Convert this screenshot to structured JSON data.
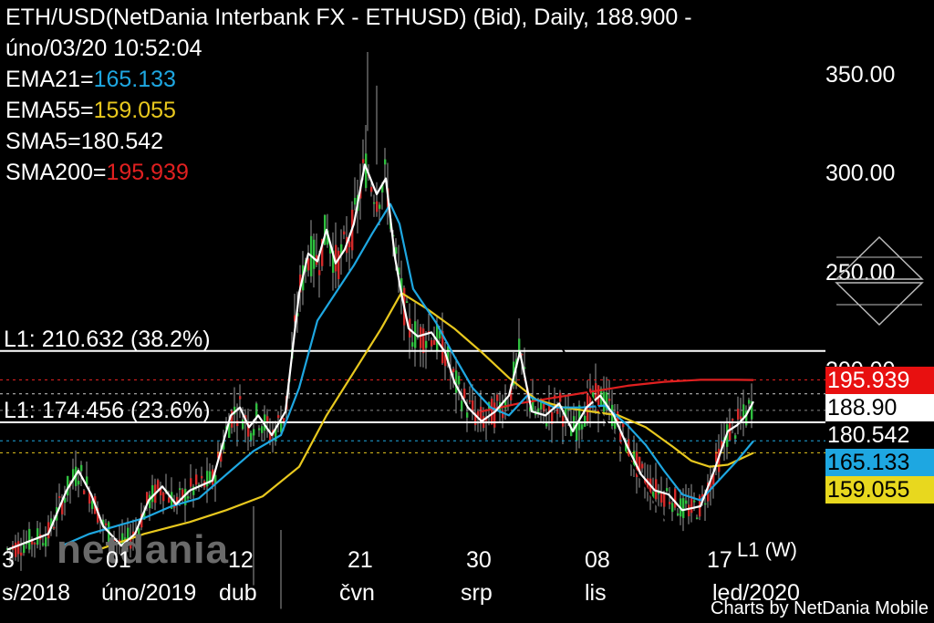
{
  "header": {
    "title_line1": "ETH/USD(NetDania Interbank FX - ETHUSD) (Bid),  Daily, 188.900 -",
    "title_line2": "úno/03/20 10:52:04",
    "indicators": [
      {
        "label": "EMA21=",
        "value": "165.133",
        "color": "#1ea7e1"
      },
      {
        "label": "EMA55=",
        "value": "159.055",
        "color": "#e8c81e"
      },
      {
        "label": "SMA5=",
        "value": "180.542",
        "color": "#ffffff"
      },
      {
        "label": "SMA200=",
        "value": "195.939",
        "color": "#e02020"
      }
    ]
  },
  "y_axis_labels": [
    "350.00",
    "300.00",
    "250.00",
    "200.00"
  ],
  "x_axis": {
    "days": [
      "3",
      "01",
      "12",
      "21",
      "30",
      "08",
      "17"
    ],
    "months": [
      "s/2018",
      "úno/2019",
      "dub",
      "čvn",
      "srp",
      "lis",
      "led/2020"
    ]
  },
  "fibo": [
    {
      "label": "L1: 210.632 (38.2%)",
      "price": 210.632
    },
    {
      "label": "L1: 174.456 (23.6%)",
      "price": 174.456
    }
  ],
  "trendline_label": "L1 (W)",
  "price_tags": [
    {
      "text": "195.939",
      "price": 195.939,
      "bg": "#e81010",
      "fg": "#ffffff"
    },
    {
      "text": "188.90",
      "price": 188.9,
      "bg": "#ffffff",
      "fg": "#000000"
    },
    {
      "text": "180.542",
      "price": 180.542,
      "bg": "#000000",
      "fg": "#ffffff"
    },
    {
      "text": "165.133",
      "price": 165.133,
      "bg": "#1ea7e1",
      "fg": "#000000"
    },
    {
      "text": "159.055",
      "price": 159.055,
      "bg": "#e8d81e",
      "fg": "#000000"
    }
  ],
  "logo_text": "netdania",
  "credit": "Charts by NetDania Mobile",
  "chart_data": {
    "type": "line",
    "title": "ETH/USD(NetDania Interbank FX - ETHUSD) (Bid),  Daily, 188.900 -",
    "ylim": [
      105,
      390
    ],
    "x_index_range": [
      0,
      870
    ],
    "series": [
      {
        "name": "SMA5",
        "color": "#ffffff",
        "x": [
          0,
          45,
          65,
          78,
          92,
          105,
          125,
          140,
          155,
          170,
          185,
          200,
          225,
          245,
          255,
          265,
          275,
          290,
          305,
          320,
          330,
          340,
          350,
          360,
          370,
          380,
          392,
          405,
          415,
          425,
          432,
          440,
          450,
          465,
          480,
          490,
          505,
          520,
          535,
          550,
          562,
          575,
          590,
          605,
          620,
          635,
          650,
          665,
          680,
          695,
          710,
          725,
          740,
          760,
          775,
          790,
          800,
          810,
          818
        ],
        "values": [
          110,
          118,
          140,
          150,
          138,
          122,
          112,
          118,
          135,
          142,
          133,
          140,
          145,
          178,
          182,
          172,
          178,
          168,
          180,
          240,
          260,
          256,
          272,
          255,
          262,
          275,
          305,
          290,
          298,
          258,
          240,
          222,
          218,
          220,
          210,
          195,
          182,
          175,
          180,
          188,
          210,
          180,
          178,
          184,
          170,
          182,
          188,
          178,
          162,
          148,
          140,
          138,
          130,
          132,
          150,
          170,
          173,
          178,
          185
        ]
      },
      {
        "name": "EMA21",
        "color": "#1ea7e1",
        "x": [
          60,
          90,
          120,
          150,
          180,
          210,
          240,
          270,
          300,
          320,
          340,
          360,
          380,
          400,
          420,
          430,
          445,
          470,
          490,
          510,
          530,
          550,
          570,
          600,
          630,
          655,
          680,
          700,
          720,
          740,
          760,
          780,
          800,
          818
        ],
        "values": [
          112,
          118,
          122,
          126,
          132,
          136,
          148,
          160,
          168,
          192,
          226,
          240,
          254,
          270,
          285,
          275,
          242,
          225,
          208,
          192,
          182,
          178,
          188,
          182,
          182,
          183,
          173,
          163,
          150,
          138,
          135,
          145,
          155,
          165
        ]
      },
      {
        "name": "EMA55",
        "color": "#e8c81e",
        "x": [
          100,
          150,
          200,
          240,
          280,
          320,
          350,
          380,
          410,
          432,
          460,
          490,
          520,
          550,
          580,
          610,
          640,
          670,
          700,
          730,
          750,
          770,
          790,
          818
        ],
        "values": [
          110,
          118,
          124,
          130,
          137,
          152,
          178,
          200,
          222,
          240,
          232,
          222,
          210,
          197,
          186,
          182,
          180,
          178,
          172,
          162,
          155,
          152,
          153,
          159
        ]
      },
      {
        "name": "SMA200",
        "color": "#e02020",
        "x": [
          520,
          560,
          600,
          640,
          680,
          720,
          760,
          800,
          818
        ],
        "values": [
          180,
          184,
          187,
          190,
          193,
          195,
          196,
          196,
          195.9
        ]
      }
    ],
    "hlines": [
      210.632,
      174.456,
      195.939,
      188.9,
      180.542,
      165.133,
      159.055
    ],
    "trendline": {
      "from": [
        395,
        375
      ],
      "to": [
        752,
        102
      ]
    }
  }
}
